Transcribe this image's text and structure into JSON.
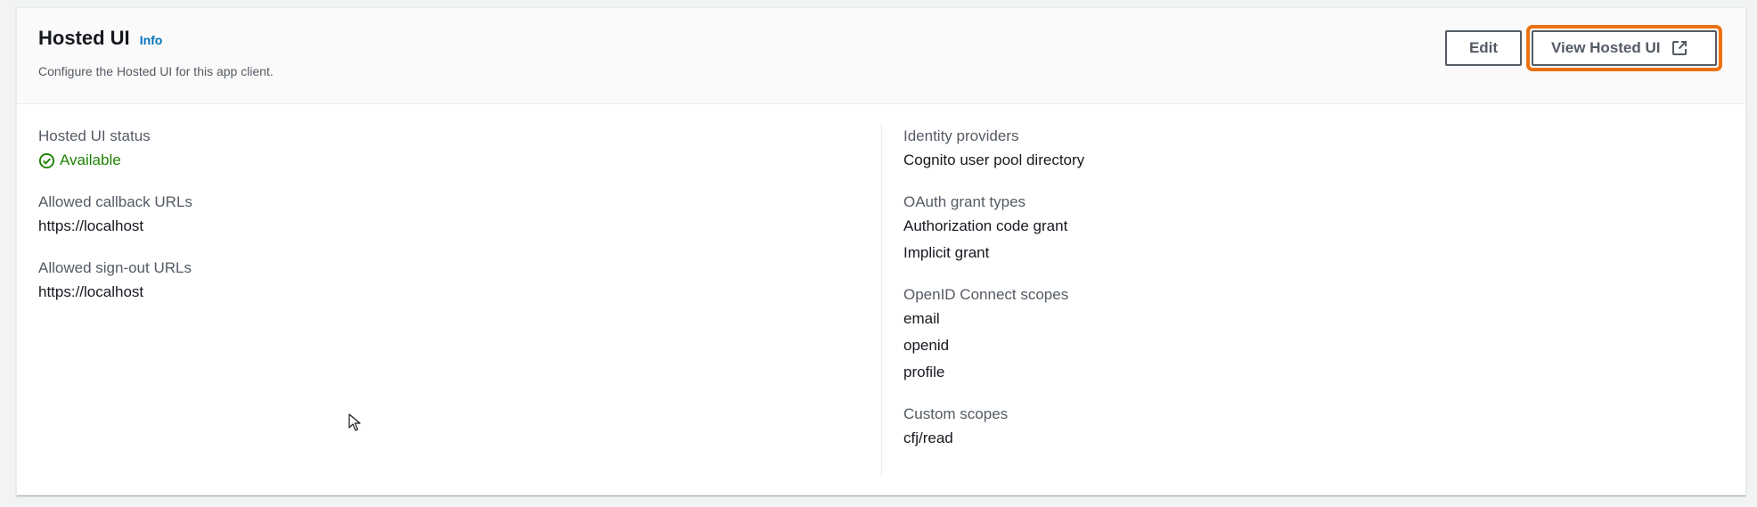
{
  "header": {
    "title": "Hosted UI",
    "info_label": "Info",
    "description": "Configure the Hosted UI for this app client.",
    "edit_label": "Edit",
    "view_label": "View Hosted UI"
  },
  "left": {
    "status": {
      "label": "Hosted UI status",
      "value": "Available"
    },
    "callback": {
      "label": "Allowed callback URLs",
      "values": [
        "https://localhost"
      ]
    },
    "signout": {
      "label": "Allowed sign-out URLs",
      "values": [
        "https://localhost"
      ]
    }
  },
  "right": {
    "idp": {
      "label": "Identity providers",
      "values": [
        "Cognito user pool directory"
      ]
    },
    "oauth": {
      "label": "OAuth grant types",
      "values": [
        "Authorization code grant",
        "Implicit grant"
      ]
    },
    "oidc": {
      "label": "OpenID Connect scopes",
      "values": [
        "email",
        "openid",
        "profile"
      ]
    },
    "custom": {
      "label": "Custom scopes",
      "values": [
        "cfj/read"
      ]
    }
  },
  "colors": {
    "link": "#0073bb",
    "success": "#1d8102",
    "focus": "#ec7211",
    "button_border": "#545b64"
  },
  "icons": {
    "status": "check-circle-icon",
    "external": "external-link-icon",
    "cursor": "mouse-cursor-icon"
  }
}
